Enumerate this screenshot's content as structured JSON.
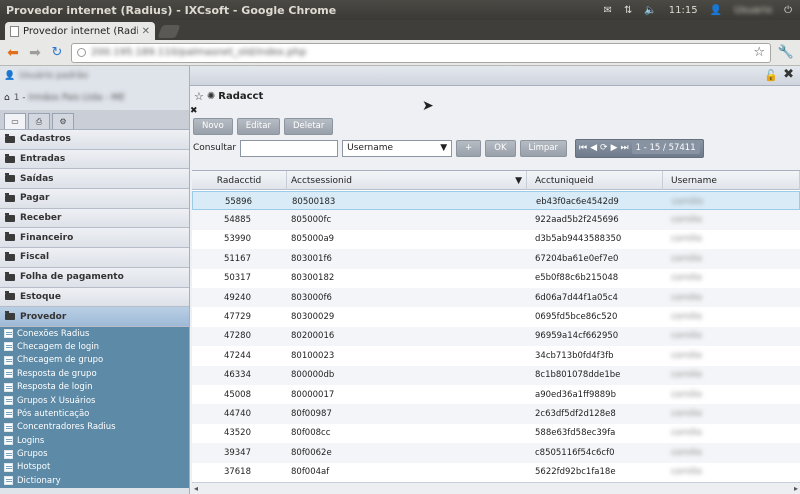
{
  "window": {
    "title": "Provedor internet (Radius) - IXCsoft - Google Chrome",
    "clock": "11:15",
    "user": "Usuario"
  },
  "browser": {
    "tab_label": "Provedor internet (Radius",
    "url": "200.195.189.110/palmasnet_old/index.php"
  },
  "sidebar": {
    "user_label": "Usuário padrão",
    "company_prefix": "1 -",
    "company_name": "Irmãos Pais Ltda - ME",
    "menu": [
      "Cadastros",
      "Entradas",
      "Saídas",
      "Pagar",
      "Receber",
      "Financeiro",
      "Fiscal",
      "Folha de pagamento",
      "Estoque",
      "Provedor"
    ],
    "submenu": [
      "Conexões Radius",
      "Checagem de login",
      "Checagem de grupo",
      "Resposta de grupo",
      "Resposta de login",
      "Grupos X Usuários",
      "Pós autenticação",
      "Concentradores Radius",
      "Logins",
      "Grupos",
      "Hotspot",
      "Dictionary"
    ]
  },
  "panel": {
    "title": "Radacct",
    "buttons": {
      "novo": "Novo",
      "editar": "Editar",
      "deletar": "Deletar"
    },
    "search": {
      "label": "Consultar",
      "field": "Username",
      "plus": "+",
      "ok": "OK",
      "limpar": "Limpar"
    },
    "pager": {
      "info": "1 - 15 / 57411"
    }
  },
  "grid": {
    "columns": [
      "Radacctid",
      "Acctsessionid",
      "Acctuniqueid",
      "Username"
    ],
    "rows": [
      {
        "radacctid": "55896",
        "acctsessionid": "80500183",
        "acctuniqueid": "eb43f0ac6e4542d9",
        "username": "cornilio"
      },
      {
        "radacctid": "54885",
        "acctsessionid": "805000fc",
        "acctuniqueid": "922aad5b2f245696",
        "username": "cornilio"
      },
      {
        "radacctid": "53990",
        "acctsessionid": "805000a9",
        "acctuniqueid": "d3b5ab9443588350",
        "username": "cornilio"
      },
      {
        "radacctid": "51167",
        "acctsessionid": "803001f6",
        "acctuniqueid": "67204ba61e0ef7e0",
        "username": "cornilio"
      },
      {
        "radacctid": "50317",
        "acctsessionid": "80300182",
        "acctuniqueid": "e5b0f88c6b215048",
        "username": "cornilio"
      },
      {
        "radacctid": "49240",
        "acctsessionid": "803000f6",
        "acctuniqueid": "6d06a7d44f1a05c4",
        "username": "cornilio"
      },
      {
        "radacctid": "47729",
        "acctsessionid": "80300029",
        "acctuniqueid": "0695fd5bce86c520",
        "username": "cornilio"
      },
      {
        "radacctid": "47280",
        "acctsessionid": "80200016",
        "acctuniqueid": "96959a14cf662950",
        "username": "cornilio"
      },
      {
        "radacctid": "47244",
        "acctsessionid": "80100023",
        "acctuniqueid": "34cb713b0fd4f3fb",
        "username": "cornilio"
      },
      {
        "radacctid": "46334",
        "acctsessionid": "800000db",
        "acctuniqueid": "8c1b801078dde1be",
        "username": "cornilio"
      },
      {
        "radacctid": "45008",
        "acctsessionid": "80000017",
        "acctuniqueid": "a90ed36a1ff9889b",
        "username": "cornilio"
      },
      {
        "radacctid": "44740",
        "acctsessionid": "80f00987",
        "acctuniqueid": "2c63df5df2d128e8",
        "username": "cornilio"
      },
      {
        "radacctid": "43520",
        "acctsessionid": "80f008cc",
        "acctuniqueid": "588e63fd58ec39fa",
        "username": "cornilio"
      },
      {
        "radacctid": "39347",
        "acctsessionid": "80f0062e",
        "acctuniqueid": "c8505116f54c6cf0",
        "username": "cornilio"
      },
      {
        "radacctid": "37618",
        "acctsessionid": "80f004af",
        "acctuniqueid": "5622fd92bc1fa18e",
        "username": "cornilio"
      }
    ]
  }
}
